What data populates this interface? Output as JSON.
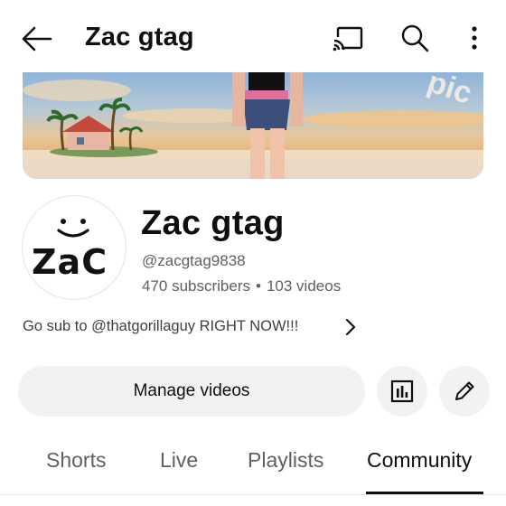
{
  "header": {
    "title": "Zac gtag",
    "icons": [
      "back-arrow-icon",
      "cast-icon",
      "search-icon",
      "more-vertical-icon"
    ]
  },
  "banner": {
    "overlay_text": "pic"
  },
  "channel": {
    "avatar_text": "ZaC",
    "name": "Zac gtag",
    "handle": "@zacgtag9838",
    "subscribers": "470 subscribers",
    "separator": "•",
    "videos": "103 videos",
    "description": "Go sub to @thatgorillaguy RIGHT NOW!!!"
  },
  "actions": {
    "manage_label": "Manage videos",
    "icons": [
      "analytics-icon",
      "edit-pencil-icon"
    ]
  },
  "tabs": [
    {
      "label": "Shorts"
    },
    {
      "label": "Live"
    },
    {
      "label": "Playlists"
    },
    {
      "label": "Community",
      "active": true
    }
  ],
  "colors": {
    "text_primary": "#0f0f0f",
    "text_secondary": "#606060",
    "chip_bg": "#f2f2f2"
  }
}
